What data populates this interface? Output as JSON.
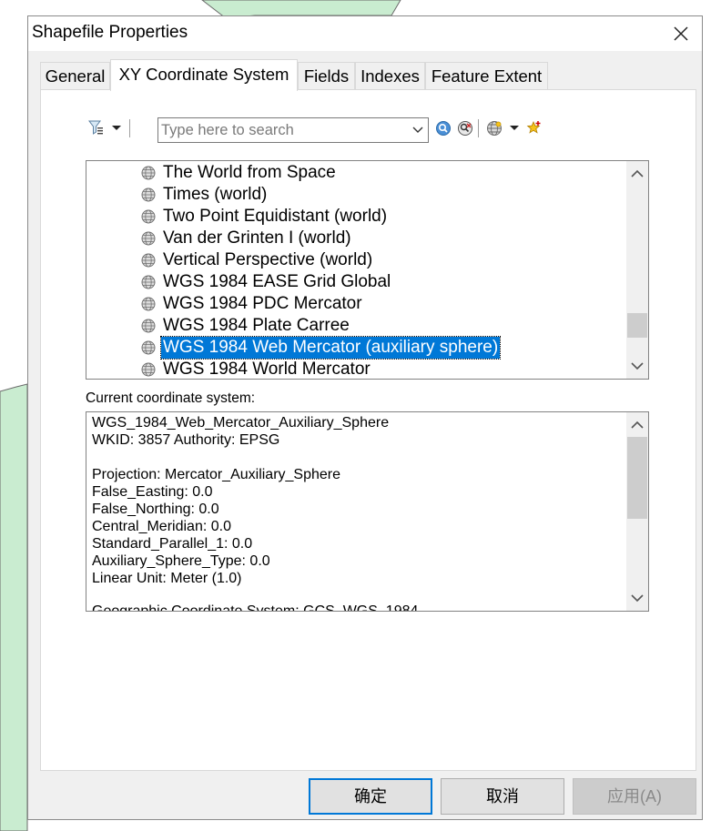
{
  "window": {
    "title": "Shapefile Properties"
  },
  "tabs": [
    {
      "label": "General"
    },
    {
      "label": "XY Coordinate System"
    },
    {
      "label": "Fields"
    },
    {
      "label": "Indexes"
    },
    {
      "label": "Feature Extent"
    }
  ],
  "active_tab": "XY Coordinate System",
  "toolbar": {
    "search_placeholder": "Type here to search",
    "icons": [
      "filter-icon",
      "dropdown-arrow-icon",
      "search-icon",
      "clear-search-icon",
      "globe-icon",
      "dropdown-arrow-icon",
      "favorite-add-icon"
    ]
  },
  "coordinate_list": {
    "items": [
      {
        "label": "The World from Space"
      },
      {
        "label": "Times (world)"
      },
      {
        "label": "Two Point Equidistant (world)"
      },
      {
        "label": "Van der Grinten I (world)"
      },
      {
        "label": "Vertical Perspective (world)"
      },
      {
        "label": "WGS 1984 EASE Grid Global"
      },
      {
        "label": "WGS 1984 PDC Mercator"
      },
      {
        "label": "WGS 1984 Plate Carree"
      },
      {
        "label": "WGS 1984 Web Mercator (auxiliary sphere)"
      },
      {
        "label": "WGS 1984 World Mercator"
      }
    ],
    "selected": "WGS 1984 Web Mercator (auxiliary sphere)",
    "item_icon": "globe-icon"
  },
  "current_system": {
    "label": "Current coordinate system:",
    "lines": [
      "WGS_1984_Web_Mercator_Auxiliary_Sphere",
      "WKID: 3857 Authority: EPSG",
      "",
      "Projection: Mercator_Auxiliary_Sphere",
      "False_Easting: 0.0",
      "False_Northing: 0.0",
      "Central_Meridian: 0.0",
      "Standard_Parallel_1: 0.0",
      "Auxiliary_Sphere_Type: 0.0",
      "Linear Unit: Meter (1.0)",
      "",
      "Geographic Coordinate System: GCS_WGS_1984"
    ]
  },
  "buttons": {
    "ok": "确定",
    "cancel": "取消",
    "apply": "应用(A)"
  },
  "colors": {
    "selection": "#0078d7",
    "dialog_bg": "#f0f0f0",
    "map_fill": "#c9ecd0"
  }
}
